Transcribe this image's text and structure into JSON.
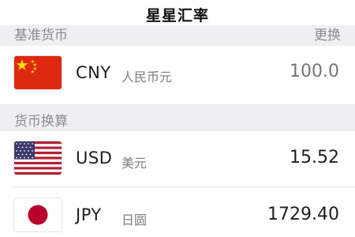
{
  "header": {
    "title": "星星汇率"
  },
  "base_section": {
    "label": "基准货币",
    "action_label": "更换"
  },
  "base_currency": {
    "code": "CNY",
    "name": "人民币元",
    "amount": "100.0",
    "flag": "china-flag"
  },
  "conversion_section": {
    "label": "货币换算"
  },
  "conversions": [
    {
      "code": "USD",
      "name": "美元",
      "amount": "15.52",
      "flag": "usa-flag"
    },
    {
      "code": "JPY",
      "name": "日圆",
      "amount": "1729.40",
      "flag": "japan-flag"
    }
  ],
  "colors": {
    "section_bg": "#efeff1",
    "muted_text": "#8a8a8f",
    "input_text": "#b4b4b4",
    "china_red": "#de2910",
    "china_yellow": "#ffde00",
    "usa_red": "#b22234",
    "usa_blue": "#3c3b6e",
    "japan_red": "#bc002d"
  }
}
